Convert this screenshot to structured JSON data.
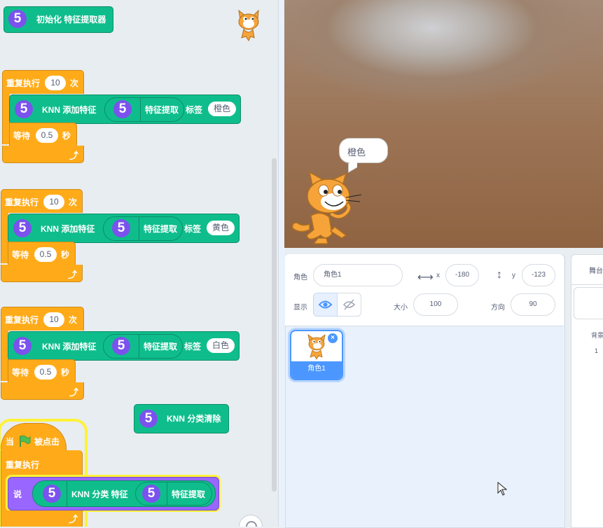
{
  "workspace": {
    "init_block": {
      "badge": "5",
      "text": "初始化 特征提取器"
    },
    "loops": [
      {
        "head": "重复执行",
        "count": "10",
        "unit": "次",
        "knn_add": "KNN 添加特征",
        "reporter": "特征提取",
        "label_word": "标签",
        "label_value": "橙色",
        "wait": "等待",
        "wait_value": "0.5",
        "sec": "秒"
      },
      {
        "head": "重复执行",
        "count": "10",
        "unit": "次",
        "knn_add": "KNN 添加特征",
        "reporter": "特征提取",
        "label_word": "标签",
        "label_value": "黄色",
        "wait": "等待",
        "wait_value": "0.5",
        "sec": "秒"
      },
      {
        "head": "重复执行",
        "count": "10",
        "unit": "次",
        "knn_add": "KNN 添加特征",
        "reporter": "特征提取",
        "label_word": "标签",
        "label_value": "白色",
        "wait": "等待",
        "wait_value": "0.5",
        "sec": "秒"
      }
    ],
    "clear_block": {
      "badge": "5",
      "text": "KNN 分类清除"
    },
    "hat": {
      "when": "当",
      "flag_icon": "green-flag-icon",
      "clicked": "被点击"
    },
    "forever": "重复执行",
    "say": {
      "label": "说",
      "knn_classify": "KNN 分类 特征",
      "reporter": "特征提取"
    },
    "badge": "5"
  },
  "stage": {
    "speech": "橙色"
  },
  "sprite_info": {
    "sprite_label": "角色",
    "sprite_name": "角色1",
    "x_label": "x",
    "x_value": "-180",
    "y_label": "y",
    "y_value": "-123",
    "show_label": "显示",
    "size_label": "大小",
    "size_value": "100",
    "direction_label": "方向",
    "direction_value": "90"
  },
  "sprites": [
    {
      "name": "角色1",
      "selected": true
    }
  ],
  "stage_panel": {
    "title": "舞台",
    "backdrop_label": "背景",
    "backdrop_count": "1"
  },
  "colors": {
    "control": "#ffab19",
    "extension": "#0fbd8c",
    "looks": "#9966ff",
    "badge": "#7b52ee",
    "selected": "#4c97ff"
  }
}
